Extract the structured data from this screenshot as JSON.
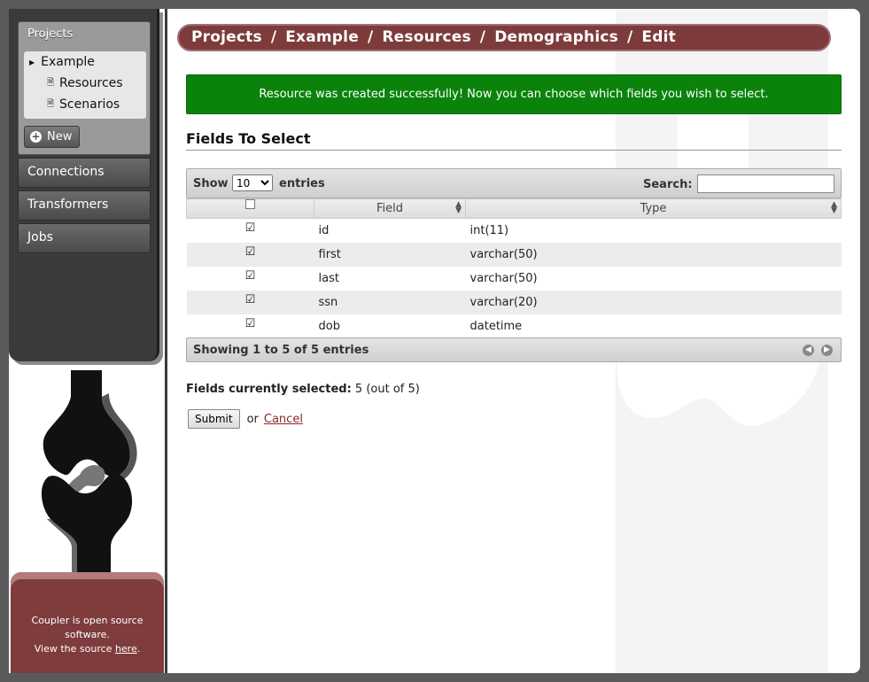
{
  "sidebar": {
    "projects_title": "Projects",
    "project_items": [
      {
        "label": "Example"
      },
      {
        "label": "Resources"
      },
      {
        "label": "Scenarios"
      }
    ],
    "new_button": "New",
    "nav": [
      {
        "label": "Connections"
      },
      {
        "label": "Transformers"
      },
      {
        "label": "Jobs"
      }
    ],
    "footer": {
      "line1": "Coupler is open source software.",
      "line2_prefix": "View the source ",
      "link": "here",
      "line2_suffix": "."
    }
  },
  "breadcrumb": [
    "Projects",
    "Example",
    "Resources",
    "Demographics",
    "Edit"
  ],
  "flash": "Resource was created successfully! Now you can choose which fields you wish to select.",
  "section_title": "Fields To Select",
  "table_controls": {
    "show_label": "Show",
    "page_size": "10",
    "entries_label": "entries",
    "search_label": "Search:",
    "search_value": ""
  },
  "table": {
    "headers": [
      "",
      "Field",
      "Type"
    ],
    "rows": [
      {
        "checked": true,
        "field": "id",
        "type": "int(11)"
      },
      {
        "checked": true,
        "field": "first",
        "type": "varchar(50)"
      },
      {
        "checked": true,
        "field": "last",
        "type": "varchar(50)"
      },
      {
        "checked": true,
        "field": "ssn",
        "type": "varchar(20)"
      },
      {
        "checked": true,
        "field": "dob",
        "type": "datetime"
      }
    ],
    "info": "Showing 1 to 5 of 5 entries"
  },
  "selection": {
    "label": "Fields currently selected",
    "value": "5 (out of 5)"
  },
  "actions": {
    "submit": "Submit",
    "or": "or",
    "cancel": "Cancel"
  }
}
